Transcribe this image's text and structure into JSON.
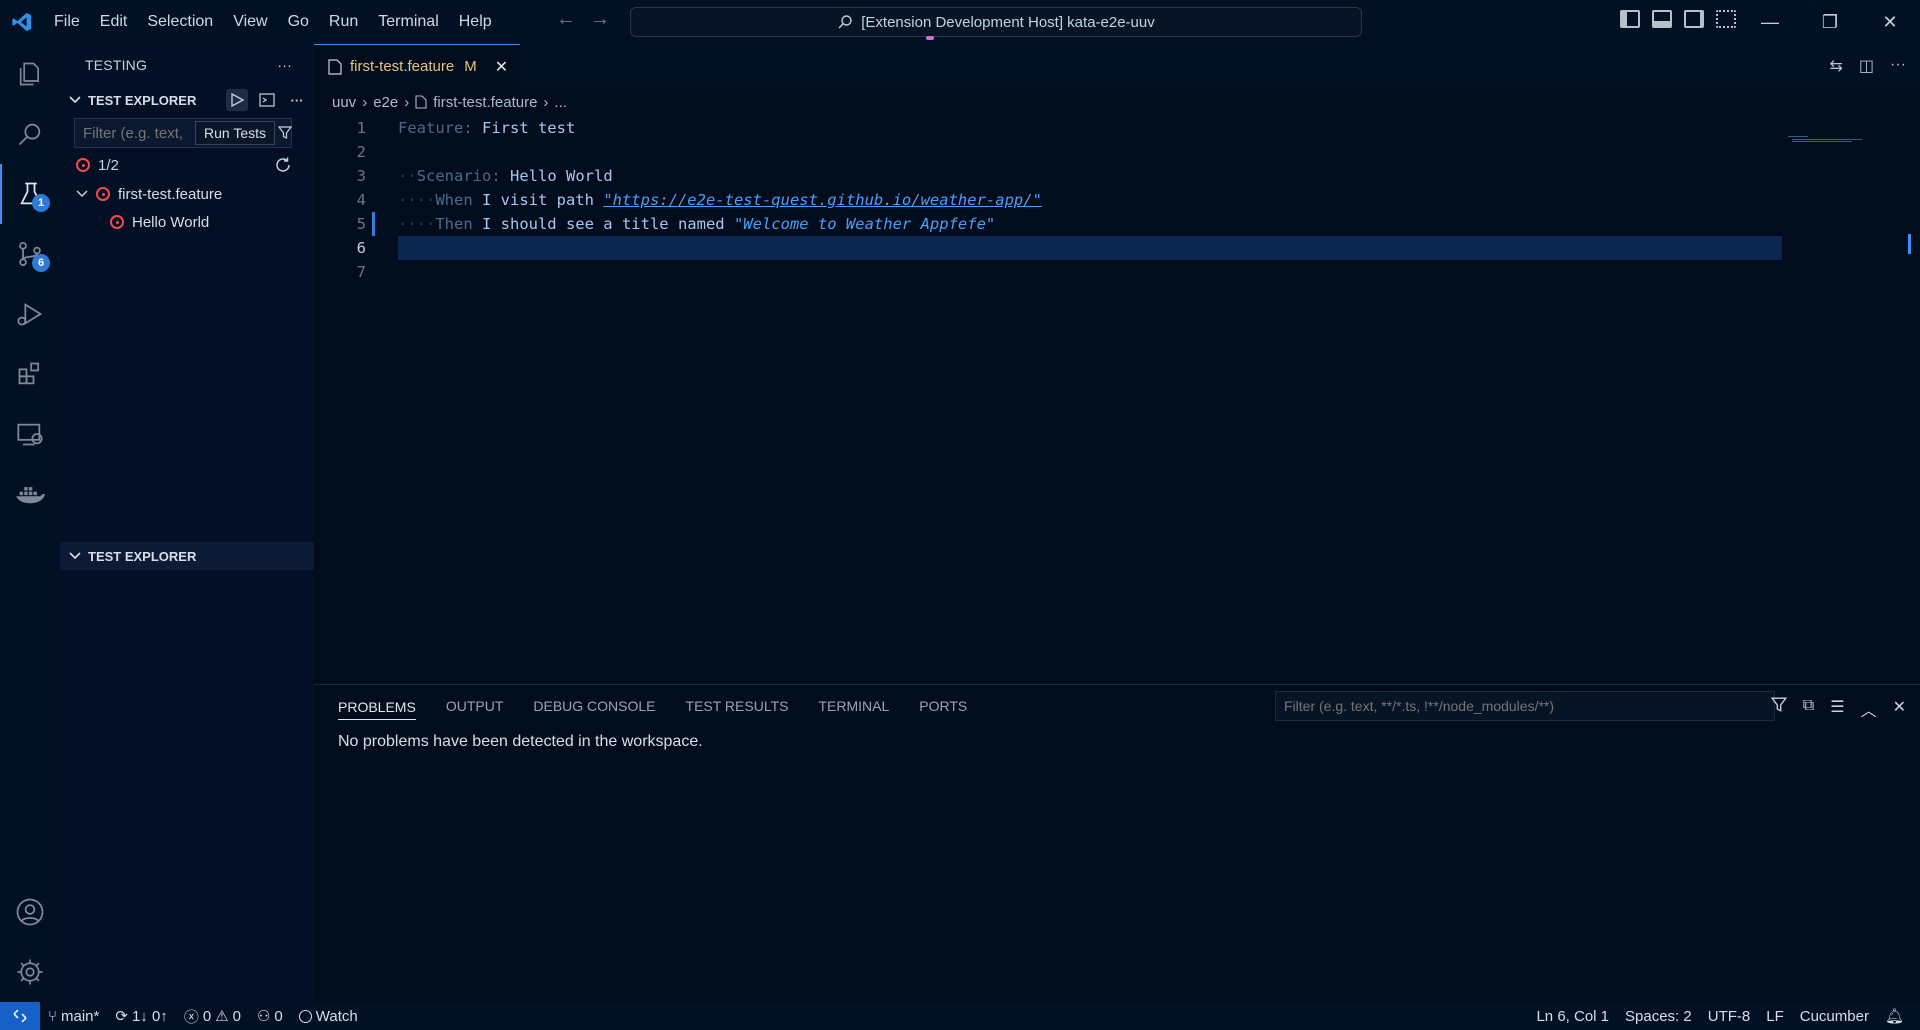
{
  "titlebar": {
    "menu": [
      "File",
      "Edit",
      "Selection",
      "View",
      "Go",
      "Run",
      "Terminal",
      "Help"
    ],
    "command_center": "[Extension Development Host] kata-e2e-uuv"
  },
  "activitybar": {
    "testing_badge": "1",
    "scm_badge": "6"
  },
  "sidebar": {
    "title": "TESTING",
    "section1_title": "TEST EXPLORER",
    "filter_placeholder": "Filter (e.g. text,",
    "tooltip": "Run Tests",
    "summary": "1/2",
    "tree": {
      "file": "first-test.feature",
      "test": "Hello World"
    },
    "section2_title": "TEST EXPLORER"
  },
  "editor": {
    "tab_name": "first-test.feature",
    "tab_modified": "M",
    "breadcrumb": [
      "uuv",
      "e2e",
      "first-test.feature",
      "..."
    ],
    "lines": {
      "l1_kw": "Feature:",
      "l1_rest": " First test",
      "l3_kw": "Scenario:",
      "l3_rest": " Hello World",
      "l4_kw": "When",
      "l4_rest": " I visit path ",
      "l4_str": "\"https://e2e-test-quest.github.io/weather-app/\"",
      "l5_kw": "Then",
      "l5_rest": " I should see a title named ",
      "l5_str": "\"Welcome to Weather Appfefe\""
    },
    "line_numbers": [
      "1",
      "2",
      "3",
      "4",
      "5",
      "6",
      "7"
    ]
  },
  "panel": {
    "tabs": [
      "PROBLEMS",
      "OUTPUT",
      "DEBUG CONSOLE",
      "TEST RESULTS",
      "TERMINAL",
      "PORTS"
    ],
    "filter_placeholder": "Filter (e.g. text, **/*.ts, !**/node_modules/**)",
    "message": "No problems have been detected in the workspace."
  },
  "statusbar": {
    "branch": "main*",
    "sync": "1↓ 0↑",
    "errors": "0",
    "warnings": "0",
    "ports": "0",
    "watch": "Watch",
    "position": "Ln 6, Col 1",
    "spaces": "Spaces: 2",
    "encoding": "UTF-8",
    "eol": "LF",
    "language": "Cucumber"
  },
  "colors": {
    "accent": "#3e8ef7",
    "error": "#f14c4c",
    "modified": "#e8c27a"
  }
}
